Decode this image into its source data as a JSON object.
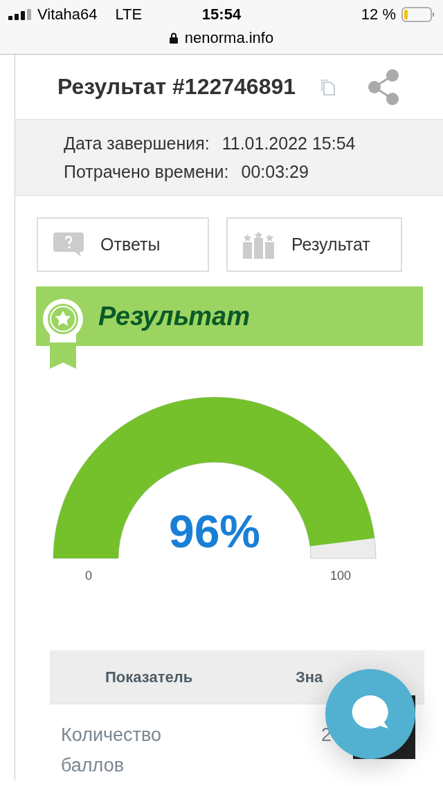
{
  "status_bar": {
    "carrier": "Vitaha64",
    "network": "LTE",
    "time": "15:54",
    "battery_text": "12 %"
  },
  "address_bar": {
    "url": "nenorma.info"
  },
  "header": {
    "title": "Результат #122746891"
  },
  "info": [
    {
      "label": "Дата завершения:",
      "value": "11.01.2022 15:54"
    },
    {
      "label": "Потрачено времени:",
      "value": "00:03:29"
    }
  ],
  "buttons": [
    {
      "kind": "answers",
      "label": "Ответы"
    },
    {
      "kind": "result",
      "label": "Результат"
    }
  ],
  "banner": {
    "title": "Результат"
  },
  "gauge": {
    "level": 0.96,
    "value_text": "96%",
    "min_label": "0",
    "max_label": "100"
  },
  "table": {
    "columns": [
      "Показатель",
      "Зна"
    ],
    "rows": [
      {
        "cells": [
          "Количество баллов",
          "2"
        ]
      }
    ]
  }
}
